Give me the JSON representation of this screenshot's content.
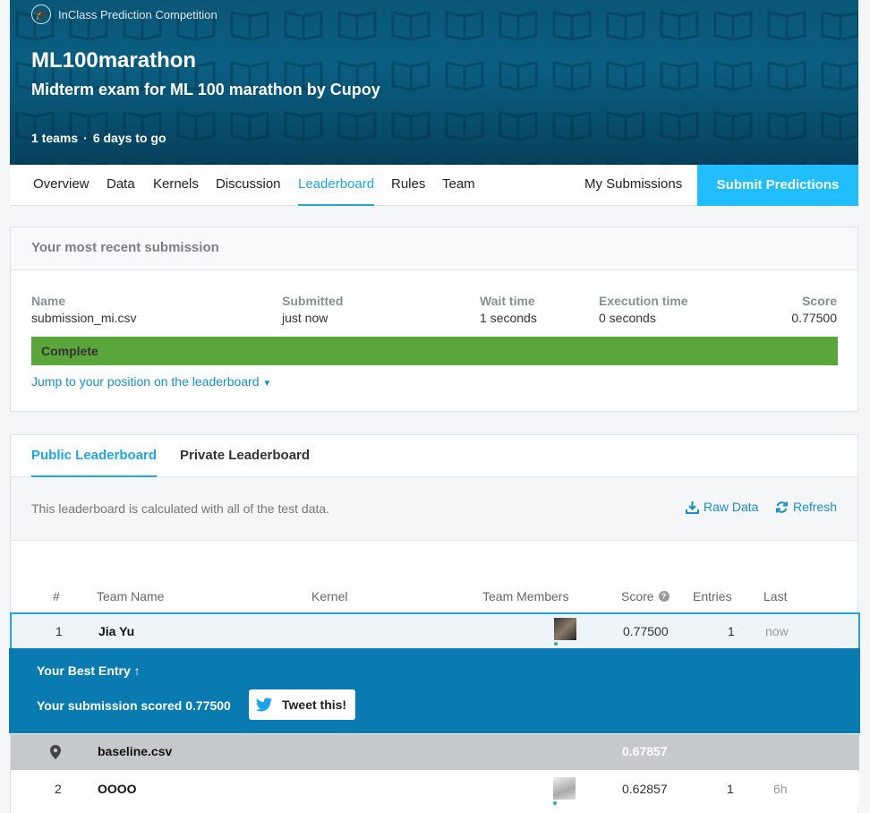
{
  "header": {
    "competition_type": "InClass Prediction Competition",
    "title": "ML100marathon",
    "subtitle": "Midterm exam for ML 100 marathon by Cupoy",
    "teams": "1 teams",
    "time_left": "6 days to go"
  },
  "nav": {
    "tabs": [
      "Overview",
      "Data",
      "Kernels",
      "Discussion",
      "Leaderboard",
      "Rules",
      "Team"
    ],
    "active_tab": "Leaderboard",
    "my_submissions": "My Submissions",
    "submit": "Submit Predictions"
  },
  "recent": {
    "heading": "Your most recent submission",
    "name_label": "Name",
    "name": "submission_mi.csv",
    "submitted_label": "Submitted",
    "submitted": "just now",
    "wait_label": "Wait time",
    "wait": "1 seconds",
    "exec_label": "Execution time",
    "exec": "0 seconds",
    "score_label": "Score",
    "score": "0.77500",
    "status": "Complete",
    "jump_link": "Jump to your position on the leaderboard"
  },
  "leaderboard": {
    "tabs": {
      "public": "Public Leaderboard",
      "private": "Private Leaderboard"
    },
    "info": "This leaderboard is calculated with all of the test data.",
    "raw_data": "Raw Data",
    "refresh": "Refresh",
    "columns": {
      "rank": "#",
      "team": "Team Name",
      "kernel": "Kernel",
      "members": "Team Members",
      "score": "Score",
      "entries": "Entries",
      "last": "Last"
    },
    "rows": [
      {
        "rank": "1",
        "team": "Jia Yu",
        "score": "0.77500",
        "entries": "1",
        "last": "now"
      },
      {
        "rank": "2",
        "team": "OOOO",
        "score": "0.62857",
        "entries": "1",
        "last": "6h"
      }
    ],
    "baseline": {
      "team": "baseline.csv",
      "score": "0.67857"
    },
    "best_entry": {
      "title": "Your Best Entry",
      "scored": "Your submission scored 0.77500",
      "tweet": "Tweet this!"
    }
  },
  "colors": {
    "accent": "#20beff",
    "link": "#1a8ec2",
    "complete": "#5ba63a",
    "best_entry_bg": "#0a7bb0",
    "banner": "#0a5f82"
  }
}
